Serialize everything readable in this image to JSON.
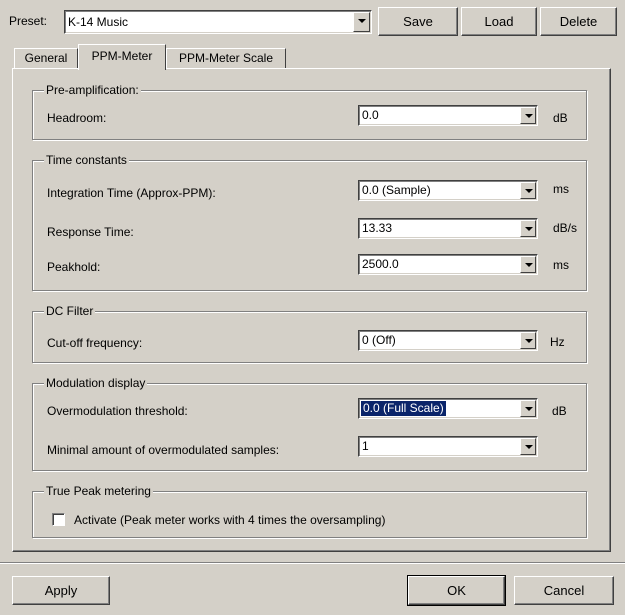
{
  "preset": {
    "label": "Preset:",
    "value": "K-14 Music",
    "save_label": "Save",
    "load_label": "Load",
    "delete_label": "Delete"
  },
  "tabs": [
    {
      "label": "General",
      "active": false
    },
    {
      "label": "PPM-Meter",
      "active": true
    },
    {
      "label": "PPM-Meter Scale",
      "active": false
    }
  ],
  "groups": {
    "preamp": {
      "title": "Pre-amplification:",
      "headroom": {
        "label": "Headroom:",
        "value": "0.0",
        "unit": "dB"
      }
    },
    "time": {
      "title": "Time constants",
      "integration": {
        "label": "Integration Time (Approx-PPM):",
        "value": "0.0 (Sample)",
        "unit": "ms"
      },
      "response": {
        "label": "Response Time:",
        "value": "13.33",
        "unit": "dB/s"
      },
      "peakhold": {
        "label": "Peakhold:",
        "value": "2500.0",
        "unit": "ms"
      }
    },
    "dc": {
      "title": "DC Filter",
      "cutoff": {
        "label": "Cut-off frequency:",
        "value": "0 (Off)",
        "unit": "Hz"
      }
    },
    "modulation": {
      "title": "Modulation display",
      "threshold": {
        "label": "Overmodulation threshold:",
        "value": "0.0 (Full Scale)",
        "unit": "dB"
      },
      "samples": {
        "label": "Minimal amount of overmodulated samples:",
        "value": "1"
      }
    },
    "truepeak": {
      "title": "True Peak metering",
      "activate_label": "Activate (Peak meter works with 4 times the oversampling)",
      "activate_checked": false
    }
  },
  "footer": {
    "apply_label": "Apply",
    "ok_label": "OK",
    "cancel_label": "Cancel"
  }
}
